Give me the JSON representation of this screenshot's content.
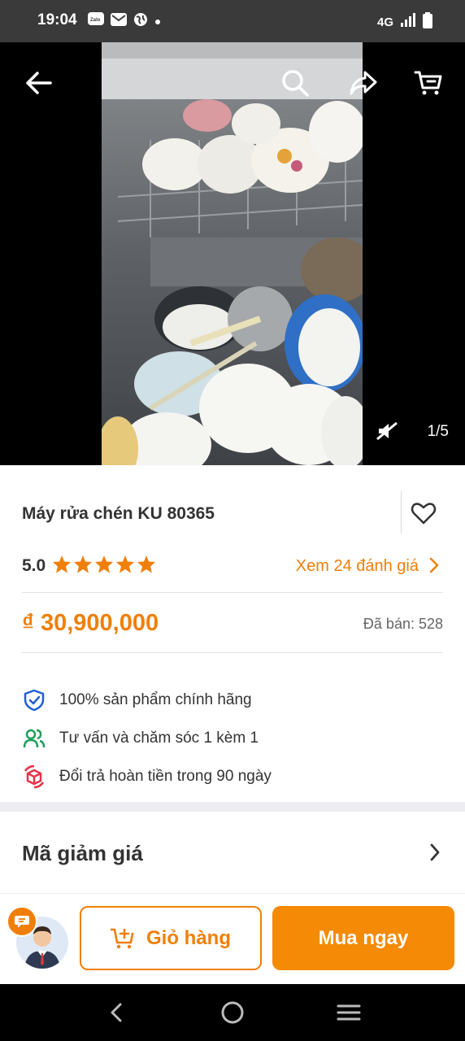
{
  "status_bar": {
    "time": "19:04",
    "network": "4G",
    "left_icons": [
      "zalo-icon",
      "mail-icon",
      "globe-icon",
      "dot-icon"
    ],
    "right_icons": [
      "signal-icon",
      "battery-icon"
    ]
  },
  "gallery": {
    "counter": "1/5",
    "image_alt": "dishwasher-photo"
  },
  "product": {
    "title": "Máy rửa chén KU 80365",
    "rating": "5.0",
    "stars": 5,
    "reviews_link": "Xem 24 đánh giá",
    "price": "₫ 30,900,000",
    "sold": "Đã bán: 528"
  },
  "perks": [
    {
      "text": "100% sản phẩm chính hãng",
      "icon": "shield-check-icon"
    },
    {
      "text": "Tư vấn và chăm sóc 1 kèm 1",
      "icon": "users-icon"
    },
    {
      "text": "Đổi trả hoàn tiền trong 90 ngày",
      "icon": "return-box-icon"
    }
  ],
  "voucher": {
    "label": "Mã giảm giá"
  },
  "actions": {
    "cart_label": "Giỏ hàng",
    "buy_label": "Mua ngay"
  },
  "colors": {
    "accent": "#f07f0a",
    "buy_button": "#f48a05",
    "star": "#f07f0a",
    "perk_icon_blue": "#1f5fd6",
    "perk_icon_green": "#1f9e5a",
    "perk_icon_red": "#e8324a"
  }
}
